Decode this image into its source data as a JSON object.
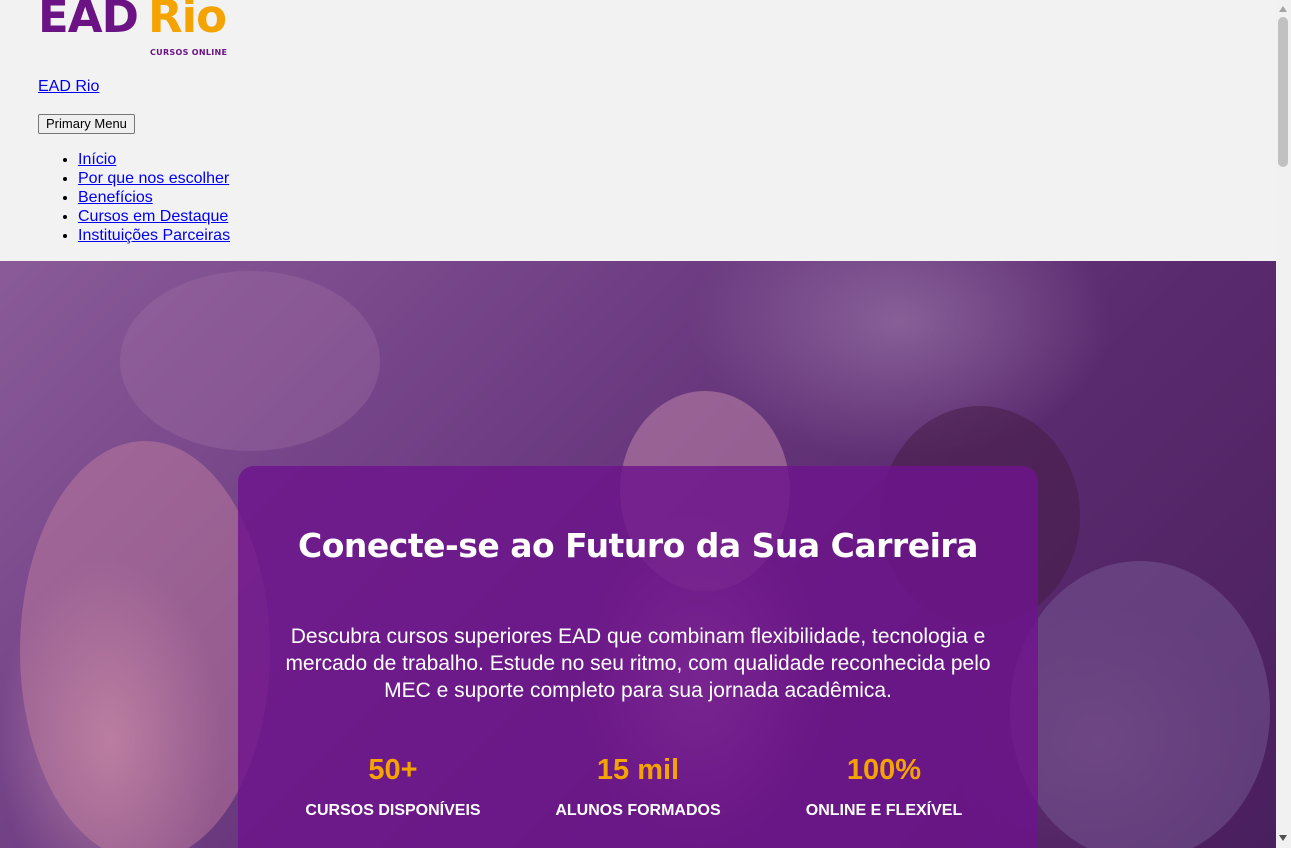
{
  "header": {
    "logo": {
      "brand_primary": "EAD",
      "brand_accent": "Rio",
      "tagline": "CURSOS ONLINE"
    },
    "site_title": "EAD Rio",
    "menu_toggle_label": "Primary Menu",
    "nav": [
      {
        "label": "Início"
      },
      {
        "label": "Por que nos escolher"
      },
      {
        "label": "Benefícios"
      },
      {
        "label": "Cursos em Destaque"
      },
      {
        "label": "Instituições Parceiras"
      }
    ]
  },
  "hero": {
    "title": "Conecte-se ao Futuro da Sua Carreira",
    "description": "Descubra cursos superiores EAD que combinam flexibilidade, tecnologia e mercado de trabalho. Estude no seu ritmo, com qualidade reconhecida pelo MEC e suporte completo para sua jornada acadêmica.",
    "stats": [
      {
        "value": "50+",
        "label": "CURSOS DISPONÍVEIS"
      },
      {
        "value": "15 mil",
        "label": "ALUNOS FORMADOS"
      },
      {
        "value": "100%",
        "label": "ONLINE E FLEXÍVEL"
      }
    ]
  },
  "colors": {
    "brand_purple": "#6b1384",
    "brand_orange": "#f5a300",
    "link_blue": "#0000ee",
    "card_overlay": "#6e148c"
  },
  "icons": {
    "scroll_up": "scroll-up-arrow-icon",
    "scroll_down": "scroll-down-arrow-icon"
  }
}
